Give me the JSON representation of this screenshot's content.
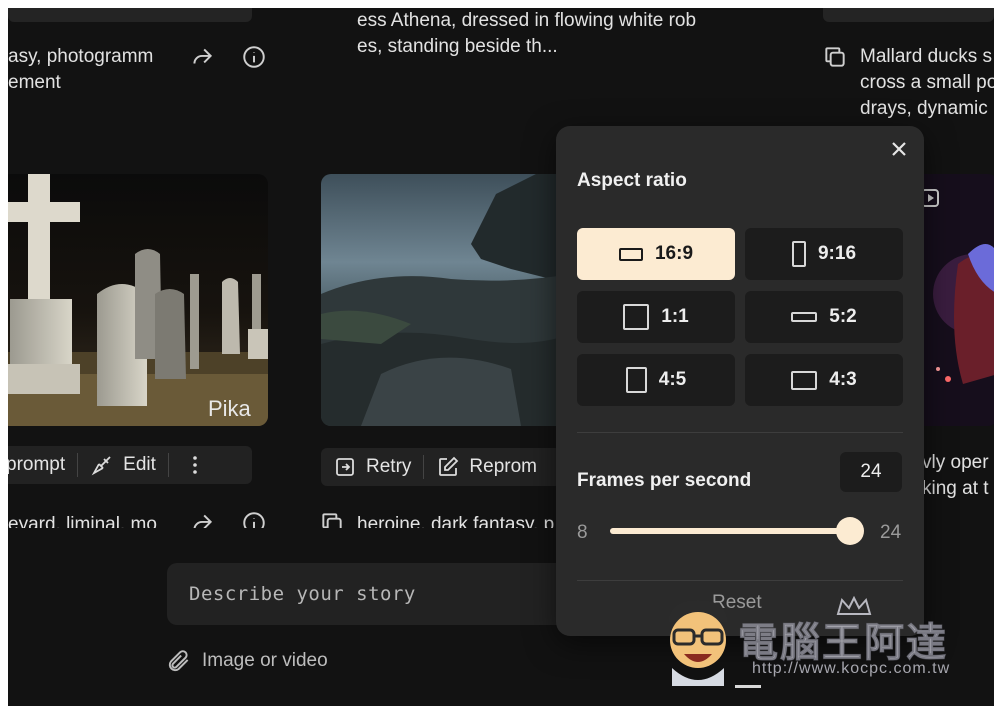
{
  "feed": {
    "captions": {
      "left_top_1": "asy, photogramm",
      "left_top_2": "ement",
      "center_top_1": "ess Athena, dressed in flowing white rob",
      "center_top_2": "es, standing beside th...",
      "right_top_1": "Mallard ducks s",
      "right_top_2": "cross a small po",
      "right_top_3": "drays, dynamic",
      "left_bottom": "eyard, liminal, mo",
      "center_bottom": "heroine, dark fantasy, p",
      "right_mid_1": "vly oper",
      "right_mid_2": "king at t"
    },
    "thumb_badge": "Pika",
    "actions_left": {
      "reprompt": "prompt",
      "edit": "Edit"
    },
    "actions_center": {
      "retry": "Retry",
      "reprompt": "Reprom"
    }
  },
  "composer": {
    "placeholder": "Describe your story",
    "attach_label": "Image or video"
  },
  "popover": {
    "aspect_title": "Aspect ratio",
    "ratios": [
      {
        "label": "16:9",
        "selected": true
      },
      {
        "label": "9:16",
        "selected": false
      },
      {
        "label": "1:1",
        "selected": false
      },
      {
        "label": "5:2",
        "selected": false
      },
      {
        "label": "4:5",
        "selected": false
      },
      {
        "label": "4:3",
        "selected": false
      }
    ],
    "fps_title": "Frames per second",
    "fps_value": "24",
    "slider_min": "8",
    "slider_max": "24",
    "slider_fraction": 1.0,
    "reset_label": "Reset"
  },
  "watermark": {
    "title": "電腦王阿達",
    "url": "http://www.kocpc.com.tw"
  },
  "colors": {
    "accent": "#fcebd2",
    "panel": "#2a2a2a",
    "background": "#121212"
  }
}
